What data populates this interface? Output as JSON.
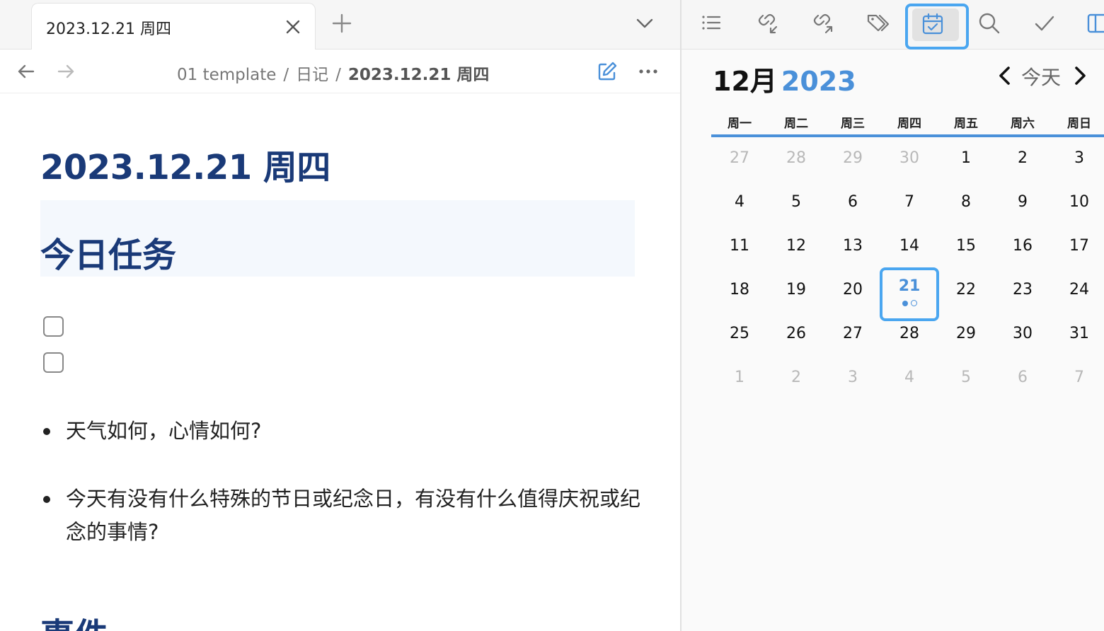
{
  "tab": {
    "title": "2023.12.21 周四"
  },
  "breadcrumb": {
    "items": [
      "01 template",
      "日记"
    ],
    "current": "2023.12.21 周四",
    "separator": "/"
  },
  "document": {
    "title": "2023.12.21 周四",
    "section_heading": "今日任务",
    "checkboxes": [
      "",
      ""
    ],
    "bullets": [
      "天气如何，心情如何?",
      "今天有没有什么特殊的节日或纪念日，有没有什么值得庆祝或纪念的事情?"
    ],
    "next_heading": "事件"
  },
  "calendar": {
    "month": "12月",
    "year": "2023",
    "today_button": "今天",
    "weekdays": [
      "周一",
      "周二",
      "周三",
      "周四",
      "周五",
      "周六",
      "周日"
    ],
    "weeks": [
      [
        {
          "d": "27",
          "m": true
        },
        {
          "d": "28",
          "m": true
        },
        {
          "d": "29",
          "m": true
        },
        {
          "d": "30",
          "m": true
        },
        {
          "d": "1"
        },
        {
          "d": "2"
        },
        {
          "d": "3"
        }
      ],
      [
        {
          "d": "4"
        },
        {
          "d": "5"
        },
        {
          "d": "6"
        },
        {
          "d": "7"
        },
        {
          "d": "8"
        },
        {
          "d": "9"
        },
        {
          "d": "10"
        }
      ],
      [
        {
          "d": "11"
        },
        {
          "d": "12"
        },
        {
          "d": "13"
        },
        {
          "d": "14"
        },
        {
          "d": "15"
        },
        {
          "d": "16"
        },
        {
          "d": "17"
        }
      ],
      [
        {
          "d": "18"
        },
        {
          "d": "19"
        },
        {
          "d": "20"
        },
        {
          "d": "21",
          "today": true
        },
        {
          "d": "22"
        },
        {
          "d": "23"
        },
        {
          "d": "24"
        }
      ],
      [
        {
          "d": "25"
        },
        {
          "d": "26"
        },
        {
          "d": "27"
        },
        {
          "d": "28"
        },
        {
          "d": "29"
        },
        {
          "d": "30"
        },
        {
          "d": "31"
        }
      ],
      [
        {
          "d": "1",
          "m": true
        },
        {
          "d": "2",
          "m": true
        },
        {
          "d": "3",
          "m": true
        },
        {
          "d": "4",
          "m": true
        },
        {
          "d": "5",
          "m": true
        },
        {
          "d": "6",
          "m": true
        },
        {
          "d": "7",
          "m": true
        }
      ]
    ]
  },
  "toolbar_icons": [
    "list-icon",
    "backlink-icon",
    "outgoing-link-icon",
    "tags-icon",
    "calendar-icon",
    "search-icon",
    "check-icon",
    "sidebar-toggle-icon"
  ],
  "colors": {
    "accent": "#4a90d9",
    "highlight_border": "#4aa6f0",
    "heading": "#1a3a78"
  }
}
